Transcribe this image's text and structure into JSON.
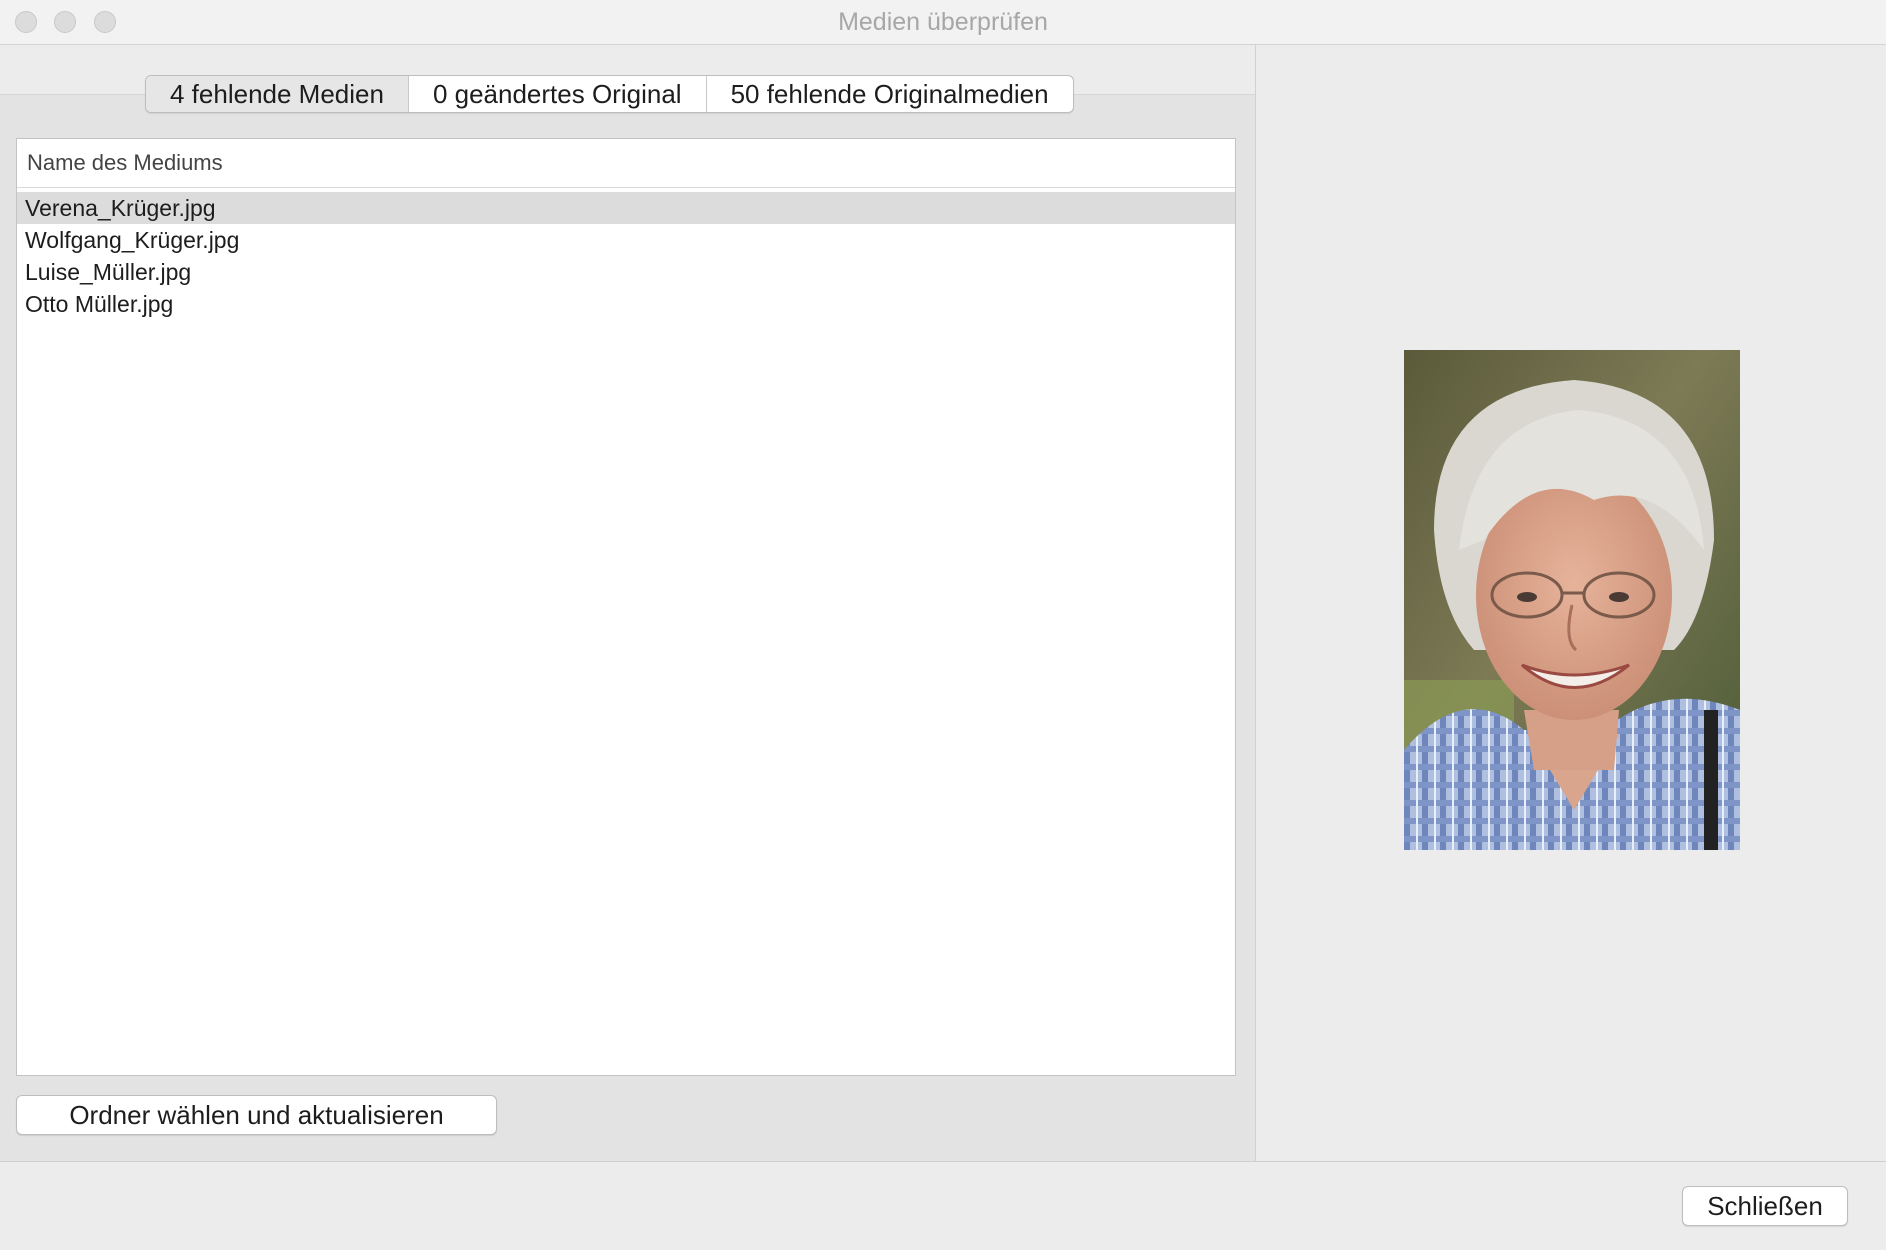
{
  "window": {
    "title": "Medien überprüfen"
  },
  "tabs": [
    {
      "label": "4 fehlende Medien",
      "selected": true
    },
    {
      "label": "0 geändertes Original",
      "selected": false
    },
    {
      "label": "50 fehlende Originalmedien",
      "selected": false
    }
  ],
  "table": {
    "column_header": "Name des Mediums",
    "rows": [
      {
        "name": "Verena_Krüger.jpg",
        "selected": true
      },
      {
        "name": "Wolfgang_Krüger.jpg",
        "selected": false
      },
      {
        "name": "Luise_Müller.jpg",
        "selected": false
      },
      {
        "name": "Otto Müller.jpg",
        "selected": false
      }
    ]
  },
  "buttons": {
    "choose_folder": "Ordner wählen und aktualisieren",
    "close": "Schließen"
  },
  "preview": {
    "icon": "portrait-photo"
  },
  "colors": {
    "selected_row": "#dcdcdc",
    "window_bg": "#ececec"
  }
}
